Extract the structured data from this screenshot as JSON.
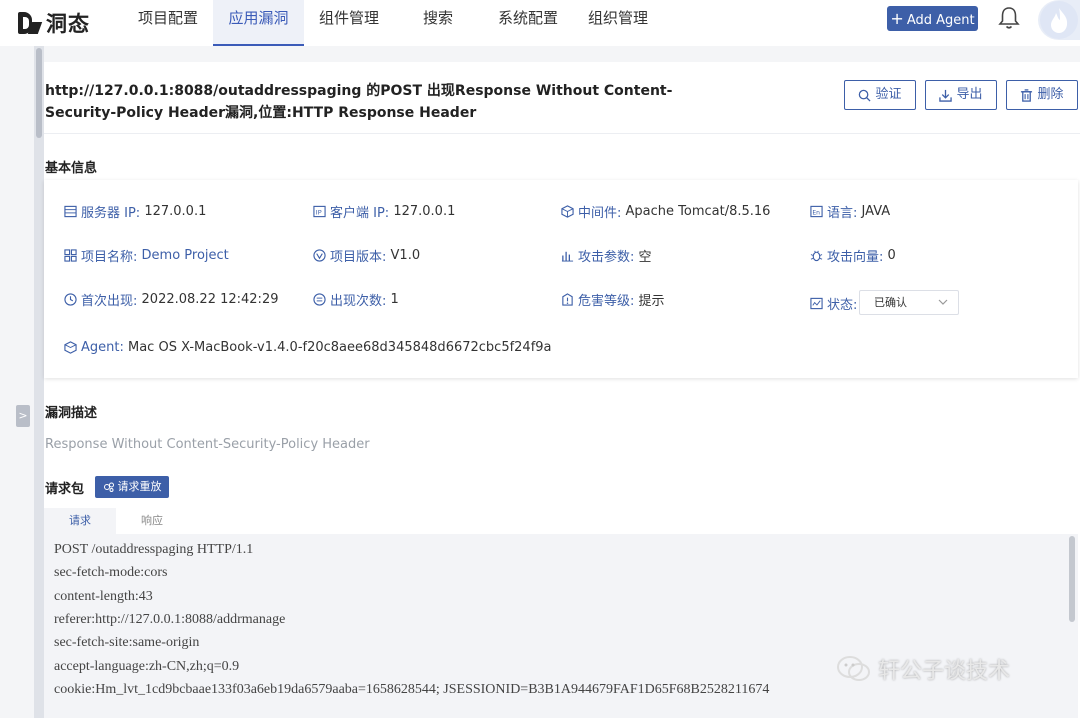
{
  "nav": {
    "logo_text": "洞态",
    "items": [
      {
        "label": "项目配置"
      },
      {
        "label": "应用漏洞",
        "active": true
      },
      {
        "label": "组件管理"
      },
      {
        "label": "搜索"
      },
      {
        "label": "系统配置"
      },
      {
        "label": "组织管理"
      }
    ],
    "add_agent_label": "Add Agent"
  },
  "vuln": {
    "title": "http://127.0.0.1:8088/outaddresspaging 的POST 出现Response Without Content-Security-Policy Header漏洞,位置:HTTP Response Header",
    "actions": {
      "verify": "验证",
      "export": "导出",
      "delete": "删除"
    }
  },
  "basic_info": {
    "heading": "基本信息",
    "fields": {
      "server_ip": {
        "label": "服务器 IP:",
        "value": "127.0.0.1"
      },
      "client_ip": {
        "label": "客户端 IP:",
        "value": "127.0.0.1"
      },
      "middleware": {
        "label": "中间件:",
        "value": "Apache Tomcat/8.5.16"
      },
      "language": {
        "label": "语言:",
        "value": "JAVA"
      },
      "project_name": {
        "label": "项目名称:",
        "value": "Demo Project"
      },
      "project_version": {
        "label": "项目版本:",
        "value": "V1.0"
      },
      "attack_param": {
        "label": "攻击参数:",
        "value": "空"
      },
      "attack_vector": {
        "label": "攻击向量:",
        "value": "0"
      },
      "first_seen": {
        "label": "首次出现:",
        "value": "2022.08.22 12:42:29"
      },
      "occurrences": {
        "label": "出现次数:",
        "value": "1"
      },
      "severity": {
        "label": "危害等级:",
        "value": "提示"
      },
      "status": {
        "label": "状态:",
        "value": "已确认"
      },
      "agent": {
        "label": "Agent:",
        "value": "Mac OS X-MacBook-v1.4.0-f20c8aee68d345848d6672cbc5f24f9a"
      }
    }
  },
  "description": {
    "heading": "漏洞描述",
    "text": "Response Without Content-Security-Policy Header"
  },
  "request": {
    "heading": "请求包",
    "replay_label": "请求重放",
    "tabs": [
      "请求",
      "响应"
    ],
    "lines": [
      "POST /outaddresspaging HTTP/1.1",
      "sec-fetch-mode:cors",
      "content-length:43",
      "referer:http://127.0.0.1:8088/addrmanage",
      "sec-fetch-site:same-origin",
      "accept-language:zh-CN,zh;q=0.9",
      "cookie:Hm_lvt_1cd9bcbaae133f03a6eb19da6579aaba=1658628544; JSESSIONID=B3B1A944679FAF1D65F68B2528211674"
    ]
  },
  "watermark": {
    "text": "轩公子谈技术"
  },
  "colors": {
    "accent": "#3d5fa8",
    "label_blue": "#3d5fa8"
  }
}
